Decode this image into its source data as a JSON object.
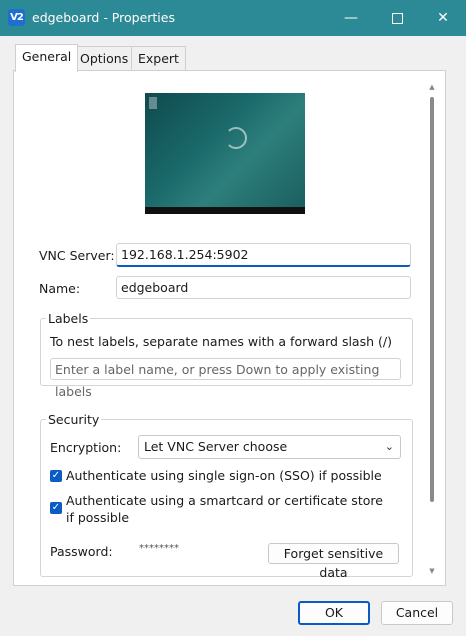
{
  "window": {
    "icon_text": "V2",
    "title": "edgeboard - Properties",
    "minimize": "—",
    "close": "✕"
  },
  "tabs": [
    {
      "label": "General",
      "active": true
    },
    {
      "label": "Options",
      "active": false
    },
    {
      "label": "Expert",
      "active": false
    }
  ],
  "general": {
    "vnc_server_label": "VNC Server:",
    "vnc_server_value": "192.168.1.254:5902",
    "name_label": "Name:",
    "name_value": "edgeboard"
  },
  "labels_group": {
    "title": "Labels",
    "hint": "To nest labels, separate names with a forward slash (/)",
    "input_placeholder": "Enter a label name, or press Down to apply existing labels"
  },
  "security": {
    "title": "Security",
    "encryption_label": "Encryption:",
    "encryption_value": "Let VNC Server choose",
    "sso_label": "Authenticate using single sign-on (SSO) if possible",
    "sso_checked": true,
    "smartcard_label": "Authenticate using a smartcard or certificate store if possible",
    "smartcard_checked": true,
    "password_label": "Password:",
    "password_value": "********",
    "forget_button": "Forget sensitive data"
  },
  "footer": {
    "ok": "OK",
    "cancel": "Cancel"
  },
  "colors": {
    "titlebar": "#2c8a96",
    "accent": "#0a5bc4"
  }
}
